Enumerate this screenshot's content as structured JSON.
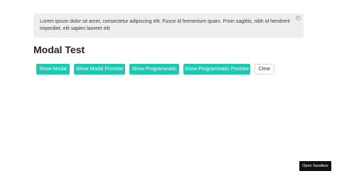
{
  "notice": {
    "text": "Lorem ipsum dolor sit amet, consectetur adipiscing elit. Fusce id fermentum quam. Proin sagittis, nibh id hendrerit imperdiet, elit sapien laoreet elit",
    "close_icon": "close-icon"
  },
  "page": {
    "title": "Modal Test"
  },
  "buttons": {
    "show_modal": "Show Modal",
    "show_modal_promise": "Show Modal Promise",
    "show_programmatic": "Show Programmatic",
    "show_programmatic_promise": "Show Programmatic Promise",
    "clear": "Clear"
  },
  "sandbox": {
    "label": "Open Sandbox"
  },
  "colors": {
    "accent": "#19c9b0",
    "notice_bg": "#eeeeee",
    "sandbox_bg": "#111111"
  }
}
